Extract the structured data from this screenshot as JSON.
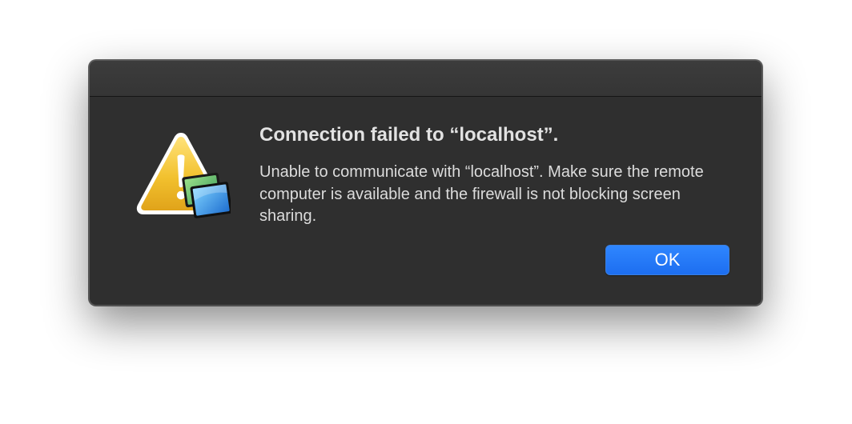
{
  "dialog": {
    "title": "Connection failed to “localhost”.",
    "message": "Unable to communicate with “localhost”. Make sure the remote computer is available and the firewall is not blocking screen sharing.",
    "ok_label": "OK",
    "icon": "warning-triangle-with-screen-sharing-badge-icon"
  },
  "colors": {
    "dialog_background": "#2f2f2f",
    "button_accent": "#2f86ff",
    "warning_yellow": "#f2c12e"
  }
}
